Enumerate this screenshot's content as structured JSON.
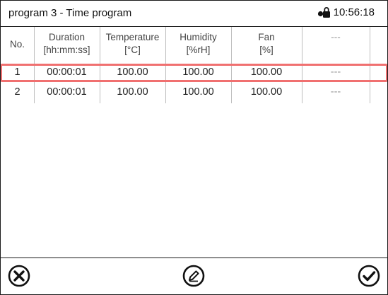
{
  "header": {
    "title": "program 3 - Time program",
    "time": "10:56:18",
    "lock_icon": "lock-icon"
  },
  "table": {
    "columns": [
      {
        "line1": "No.",
        "line2": ""
      },
      {
        "line1": "Duration",
        "line2": "[hh:mm:ss]"
      },
      {
        "line1": "Temperature",
        "line2": "[°C]"
      },
      {
        "line1": "Humidity",
        "line2": "[%rH]"
      },
      {
        "line1": "Fan",
        "line2": "[%]"
      },
      {
        "line1": "---",
        "line2": ""
      }
    ],
    "rows": [
      {
        "no": "1",
        "duration": "00:00:01",
        "temperature": "100.00",
        "humidity": "100.00",
        "fan": "100.00",
        "extra": "---",
        "selected": true
      },
      {
        "no": "2",
        "duration": "00:00:01",
        "temperature": "100.00",
        "humidity": "100.00",
        "fan": "100.00",
        "extra": "---",
        "selected": false
      }
    ]
  },
  "footer": {
    "cancel_icon": "close-circle-icon",
    "edit_icon": "pencil-circle-icon",
    "confirm_icon": "check-circle-icon"
  },
  "colors": {
    "selection_outline": "#f07070",
    "grid_line": "#bdbdbd"
  }
}
